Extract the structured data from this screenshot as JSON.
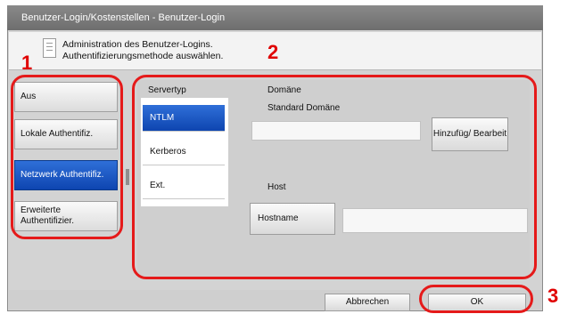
{
  "window": {
    "title": "Benutzer-Login/Kostenstellen - Benutzer-Login"
  },
  "header": {
    "message_line1": "Administration des Benutzer-Logins.",
    "message_line2": "Authentifizierungsmethode auswählen."
  },
  "callouts": [
    "1",
    "2",
    "3"
  ],
  "auth_methods": [
    {
      "label": "Aus",
      "selected": false
    },
    {
      "label": "Lokale Authentifiz.",
      "selected": false
    },
    {
      "label": "Netzwerk Authentifiz.",
      "selected": true
    },
    {
      "label": "Erweiterte Authentifizier.",
      "selected": false
    }
  ],
  "server": {
    "label": "Servertyp",
    "types": [
      {
        "label": "NTLM",
        "selected": true
      },
      {
        "label": "Kerberos",
        "selected": false
      },
      {
        "label": "Ext.",
        "selected": false
      }
    ]
  },
  "domain": {
    "label": "Domäne",
    "standard_label": "Standard Domäne",
    "value": "",
    "edit_button": "Hinzufüg/ Bearbeit"
  },
  "host": {
    "label": "Host",
    "hostname_button": "Hostname",
    "value": ""
  },
  "footer": {
    "cancel": "Abbrechen",
    "ok": "OK"
  },
  "colors": {
    "selected_blue": "#1656c4",
    "callout_red": "#e51a1a"
  }
}
